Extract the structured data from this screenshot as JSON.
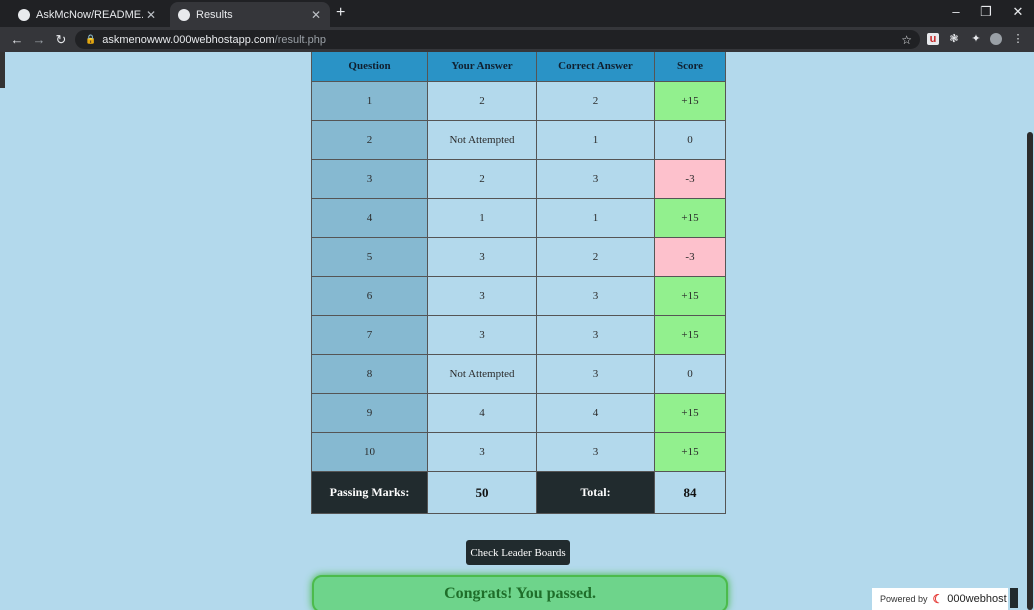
{
  "browser": {
    "tabs": [
      {
        "title": "AskMcNow/README.md at mai",
        "icon": "github-icon",
        "active": false
      },
      {
        "title": "Results",
        "icon": "globe-icon",
        "active": true
      }
    ],
    "address": {
      "host": "askmenowww.000webhostapp.com",
      "path": "/result.php"
    }
  },
  "table": {
    "headers": [
      "Question",
      "Your Answer",
      "Correct Answer",
      "Score"
    ],
    "rows": [
      {
        "q": "1",
        "your": "2",
        "correct": "2",
        "score": "+15",
        "status": "pos"
      },
      {
        "q": "2",
        "your": "Not Attempted",
        "correct": "1",
        "score": "0",
        "status": "zero"
      },
      {
        "q": "3",
        "your": "2",
        "correct": "3",
        "score": "-3",
        "status": "neg"
      },
      {
        "q": "4",
        "your": "1",
        "correct": "1",
        "score": "+15",
        "status": "pos"
      },
      {
        "q": "5",
        "your": "3",
        "correct": "2",
        "score": "-3",
        "status": "neg"
      },
      {
        "q": "6",
        "your": "3",
        "correct": "3",
        "score": "+15",
        "status": "pos"
      },
      {
        "q": "7",
        "your": "3",
        "correct": "3",
        "score": "+15",
        "status": "pos"
      },
      {
        "q": "8",
        "your": "Not Attempted",
        "correct": "3",
        "score": "0",
        "status": "zero"
      },
      {
        "q": "9",
        "your": "4",
        "correct": "4",
        "score": "+15",
        "status": "pos"
      },
      {
        "q": "10",
        "your": "3",
        "correct": "3",
        "score": "+15",
        "status": "pos"
      }
    ],
    "footer": {
      "passing_label": "Passing Marks:",
      "passing_value": "50",
      "total_label": "Total:",
      "total_value": "84"
    }
  },
  "leader_button": "Check Leader Boards",
  "congrats": "Congrats! You passed.",
  "powered": {
    "label": "Powered by",
    "brand": "000webhost"
  },
  "colors": {
    "correct": "#92f08e",
    "wrong": "#fdc1cc",
    "header": "#2a93c6",
    "dark": "#212b2e",
    "bg": "#b3d9ec"
  }
}
